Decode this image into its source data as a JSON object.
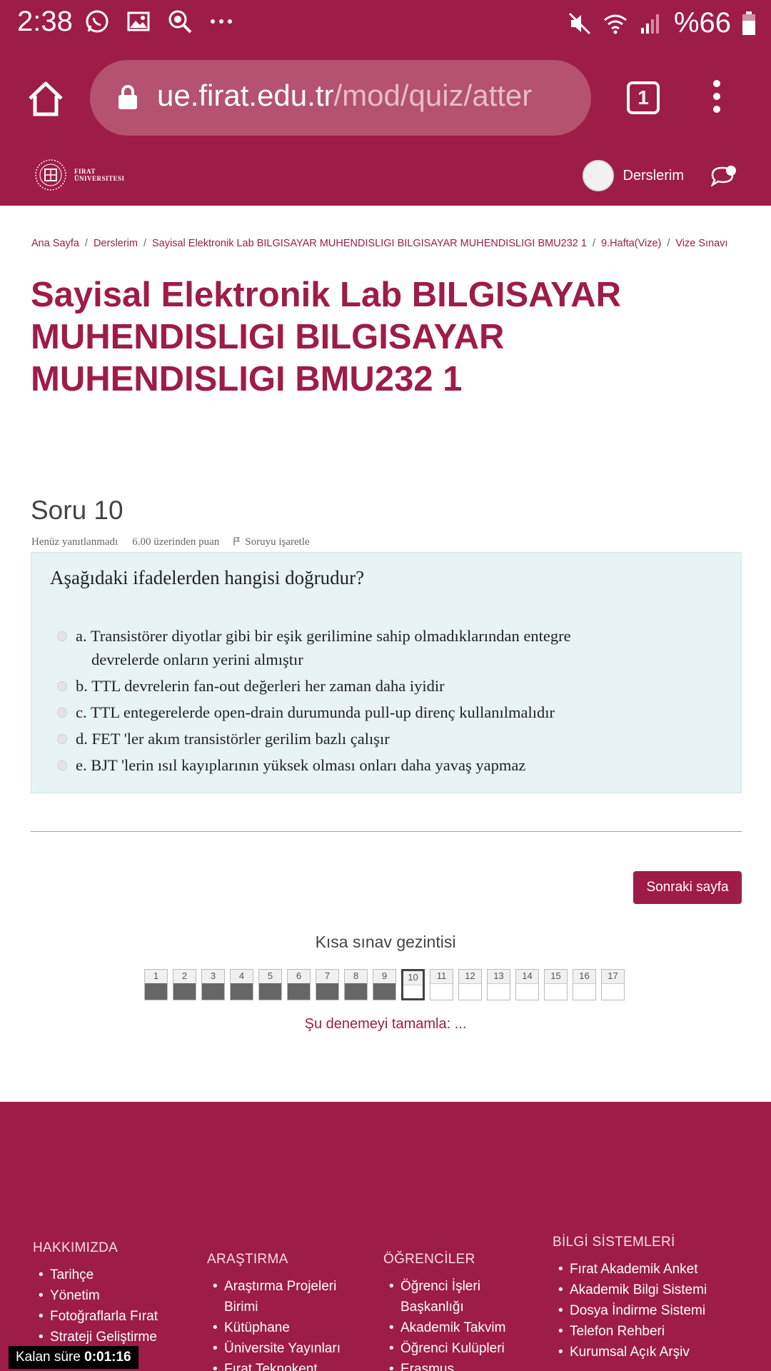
{
  "status_bar": {
    "time": "2:38",
    "battery": "%66",
    "icons_left": [
      "whatsapp-icon",
      "gallery-icon",
      "bug-search-icon",
      "more-icon"
    ],
    "icons_right": [
      "mute-icon",
      "wifi-icon",
      "signal-icon",
      "battery-icon"
    ]
  },
  "browser": {
    "url_domain": "ue.firat.edu.tr",
    "url_path": "/mod/quiz/atter",
    "tab_count": "1"
  },
  "site": {
    "logo_text_line1": "FIRAT",
    "logo_text_line2": "ÜNIVERSITESI",
    "user_menu_label": "Derslerim"
  },
  "breadcrumb": [
    "Ana Sayfa",
    "Derslerim",
    "Sayisal Elektronik Lab BILGISAYAR MUHENDISLIGI BILGISAYAR MUHENDISLIGI BMU232 1",
    "9.Hafta(Vize)",
    "Vize Sınavı"
  ],
  "page_title": "Sayisal Elektronik Lab BILGISAYAR MUHENDISLIGI BILGISAYAR MUHENDISLIGI BMU232 1",
  "question": {
    "title": "Soru 10",
    "status": "Henüz yanıtlanmadı",
    "points": "6.00 üzerinden puan",
    "flag_label": "Soruyu işaretle",
    "text": "Aşağıdaki ifadelerden hangisi doğrudur?",
    "answers": [
      {
        "line1": "a. Transistörer diyotlar gibi bir eşik gerilimine sahip olmadıklarından entegre",
        "line2": "devrelerde onların yerini almıştır"
      },
      {
        "line1": "b. TTL devrelerin fan-out değerleri her zaman daha iyidir",
        "line2": ""
      },
      {
        "line1": "c. TTL entegerelerde open-drain durumunda pull-up direnç kullanılmalıdır",
        "line2": ""
      },
      {
        "line1": "d. FET 'ler akım transistörler gerilim bazlı çalışır",
        "line2": ""
      },
      {
        "line1": "e. BJT 'lerin ısıl kayıplarının yüksek olması onları daha yavaş yapmaz",
        "line2": ""
      }
    ]
  },
  "next_button": "Sonraki sayfa",
  "quiz_nav": {
    "title": "Kısa sınav gezintisi",
    "cells": [
      {
        "n": "1",
        "answered": true
      },
      {
        "n": "2",
        "answered": true
      },
      {
        "n": "3",
        "answered": true
      },
      {
        "n": "4",
        "answered": true
      },
      {
        "n": "5",
        "answered": true
      },
      {
        "n": "6",
        "answered": true
      },
      {
        "n": "7",
        "answered": true
      },
      {
        "n": "8",
        "answered": true
      },
      {
        "n": "9",
        "answered": true
      },
      {
        "n": "10",
        "answered": false,
        "current": true
      },
      {
        "n": "11",
        "answered": false
      },
      {
        "n": "12",
        "answered": false
      },
      {
        "n": "13",
        "answered": false
      },
      {
        "n": "14",
        "answered": false
      },
      {
        "n": "15",
        "answered": false
      },
      {
        "n": "16",
        "answered": false
      },
      {
        "n": "17",
        "answered": false
      }
    ],
    "finish_link": "Şu denemeyi tamamla: ..."
  },
  "footer": {
    "col1": {
      "title": "HAKKIMIZDA",
      "items": [
        "Tarihçe",
        "Yönetim",
        "Fotoğraflarla Fırat",
        "Strateji Geliştirme"
      ]
    },
    "col2": {
      "title": "ARAŞTIRMA",
      "items": [
        "Araştırma Projeleri|Birimi",
        "Kütüphane",
        "Üniversite Yayınları",
        "Fırat Teknokent"
      ]
    },
    "col3": {
      "title": "ÖĞRENCİLER",
      "items": [
        "Öğrenci İşleri|Başkanlığı",
        "Akademik Takvim",
        "Öğrenci Kulüpleri",
        "Erasmus"
      ]
    },
    "col4": {
      "title": "BİLGİ SİSTEMLERİ",
      "items": [
        "Fırat Akademik Anket",
        "Akademik Bilgi Sistemi",
        "Dosya İndirme Sistemi",
        "Telefon Rehberi",
        "Kurumsal Açık Arşiv"
      ]
    }
  },
  "timer": {
    "label": "Kalan süre",
    "value": "0:01:16"
  },
  "colors": {
    "brand": "#9e1c48",
    "question_bg": "#e7f3f5"
  }
}
